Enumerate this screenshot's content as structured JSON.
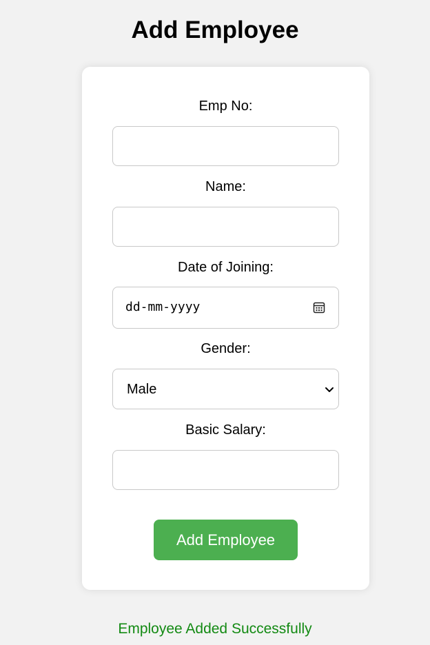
{
  "page": {
    "title": "Add Employee"
  },
  "form": {
    "emp_no": {
      "label": "Emp No:",
      "value": ""
    },
    "name": {
      "label": "Name:",
      "value": ""
    },
    "date_of_joining": {
      "label": "Date of Joining:",
      "placeholder": "dd-mm-yyyy",
      "icon": "calendar-icon"
    },
    "gender": {
      "label": "Gender:",
      "selected": "Male",
      "icon": "chevron-down-icon"
    },
    "basic_salary": {
      "label": "Basic Salary:",
      "value": ""
    },
    "submit_label": "Add Employee"
  },
  "status": {
    "message": "Employee Added Successfully",
    "color": "#138a13"
  },
  "colors": {
    "accent": "#4caf50",
    "background": "#f2f2f2",
    "card": "#ffffff"
  }
}
